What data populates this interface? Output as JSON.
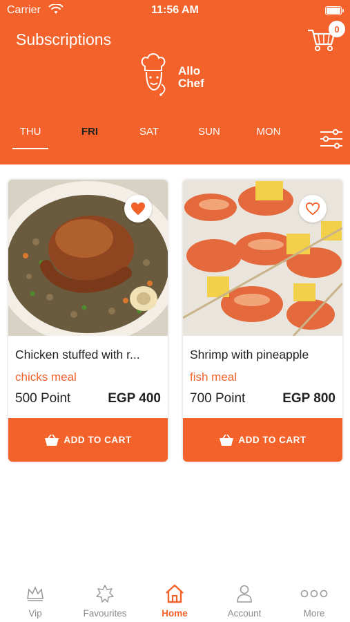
{
  "status": {
    "carrier": "Carrier",
    "time": "11:56 AM"
  },
  "header": {
    "title": "Subscriptions",
    "cart_count": "0",
    "logo_top": "Allo",
    "logo_bottom": "Chef"
  },
  "days": [
    {
      "label": "THU",
      "active": true
    },
    {
      "label": "FRI",
      "selected": true
    },
    {
      "label": "SAT"
    },
    {
      "label": "SUN"
    },
    {
      "label": "MON"
    }
  ],
  "products": [
    {
      "name": "Chicken stuffed with r...",
      "category": "chicks meal",
      "points": "500 Point",
      "price": "EGP 400",
      "favorite": true,
      "button": "ADD TO CART"
    },
    {
      "name": "Shrimp with pineapple",
      "category": "fish meal",
      "points": "700 Point",
      "price": "EGP 800",
      "favorite": false,
      "button": "ADD TO CART"
    }
  ],
  "tabs": [
    {
      "label": "Vip",
      "icon": "crown-icon"
    },
    {
      "label": "Favourites",
      "icon": "star-badge-icon"
    },
    {
      "label": "Home",
      "icon": "home-icon",
      "active": true
    },
    {
      "label": "Account",
      "icon": "person-icon"
    },
    {
      "label": "More",
      "icon": "more-dots-icon"
    }
  ],
  "colors": {
    "accent": "#f2622a",
    "text": "#222222",
    "muted": "#8a8a8a"
  }
}
